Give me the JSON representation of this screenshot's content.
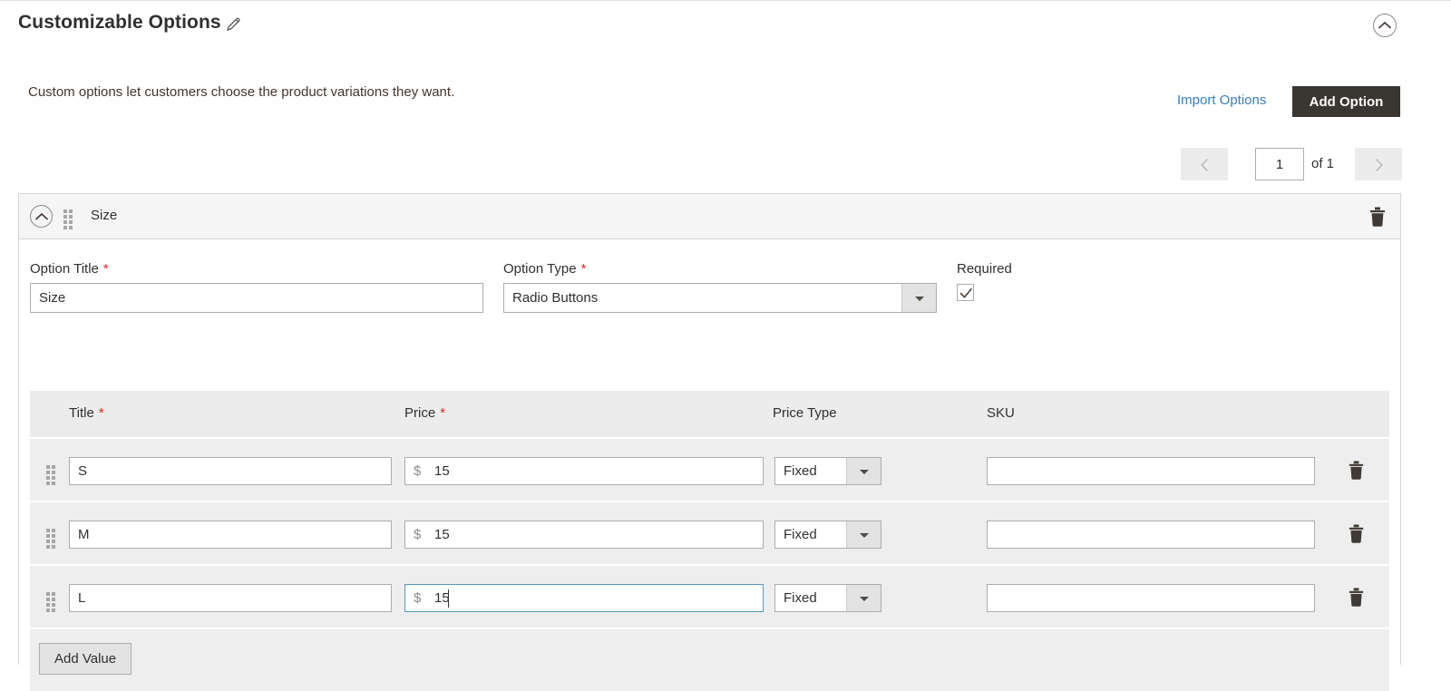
{
  "header": {
    "title": "Customizable Options",
    "edit_icon": "pencil-icon",
    "collapse_icon": "chevron-up-circle-icon"
  },
  "intro": {
    "description": "Custom options let customers choose the product variations they want.",
    "import_link": "Import Options",
    "add_option_button": "Add Option"
  },
  "pagination": {
    "prev_icon": "chevron-left-icon",
    "next_icon": "chevron-right-icon",
    "current_page": "1",
    "of_label": "of 1"
  },
  "option": {
    "collapse_icon": "chevron-up-circle-icon",
    "drag_icon": "drag-handle-icon",
    "name": "Size",
    "delete_icon": "trash-icon",
    "fields": {
      "option_title_label": "Option Title",
      "option_title_value": "Size",
      "option_type_label": "Option Type",
      "option_type_value": "Radio Buttons",
      "required_label": "Required",
      "required_checked": true,
      "required_icon": "check-icon",
      "required_marker": "*"
    },
    "values_table": {
      "columns": {
        "title": "Title",
        "price": "Price",
        "price_type": "Price Type",
        "sku": "SKU"
      },
      "required_marker": "*",
      "currency_symbol": "$",
      "rows": [
        {
          "drag_icon": "drag-handle-icon",
          "title": "S",
          "price": "15",
          "price_type": "Fixed",
          "sku": "",
          "focused": false,
          "delete_icon": "trash-icon"
        },
        {
          "drag_icon": "drag-handle-icon",
          "title": "M",
          "price": "15",
          "price_type": "Fixed",
          "sku": "",
          "focused": false,
          "delete_icon": "trash-icon"
        },
        {
          "drag_icon": "drag-handle-icon",
          "title": "L",
          "price": "15",
          "price_type": "Fixed",
          "sku": "",
          "focused": true,
          "delete_icon": "trash-icon"
        }
      ],
      "add_value_button": "Add Value"
    }
  },
  "colors": {
    "accent_link": "#3b7fb6",
    "primary_button": "#3a3632",
    "required_star": "#e22626",
    "focus_border": "#5297c7",
    "row_background": "#eeeeee",
    "header_background": "#ececec"
  }
}
